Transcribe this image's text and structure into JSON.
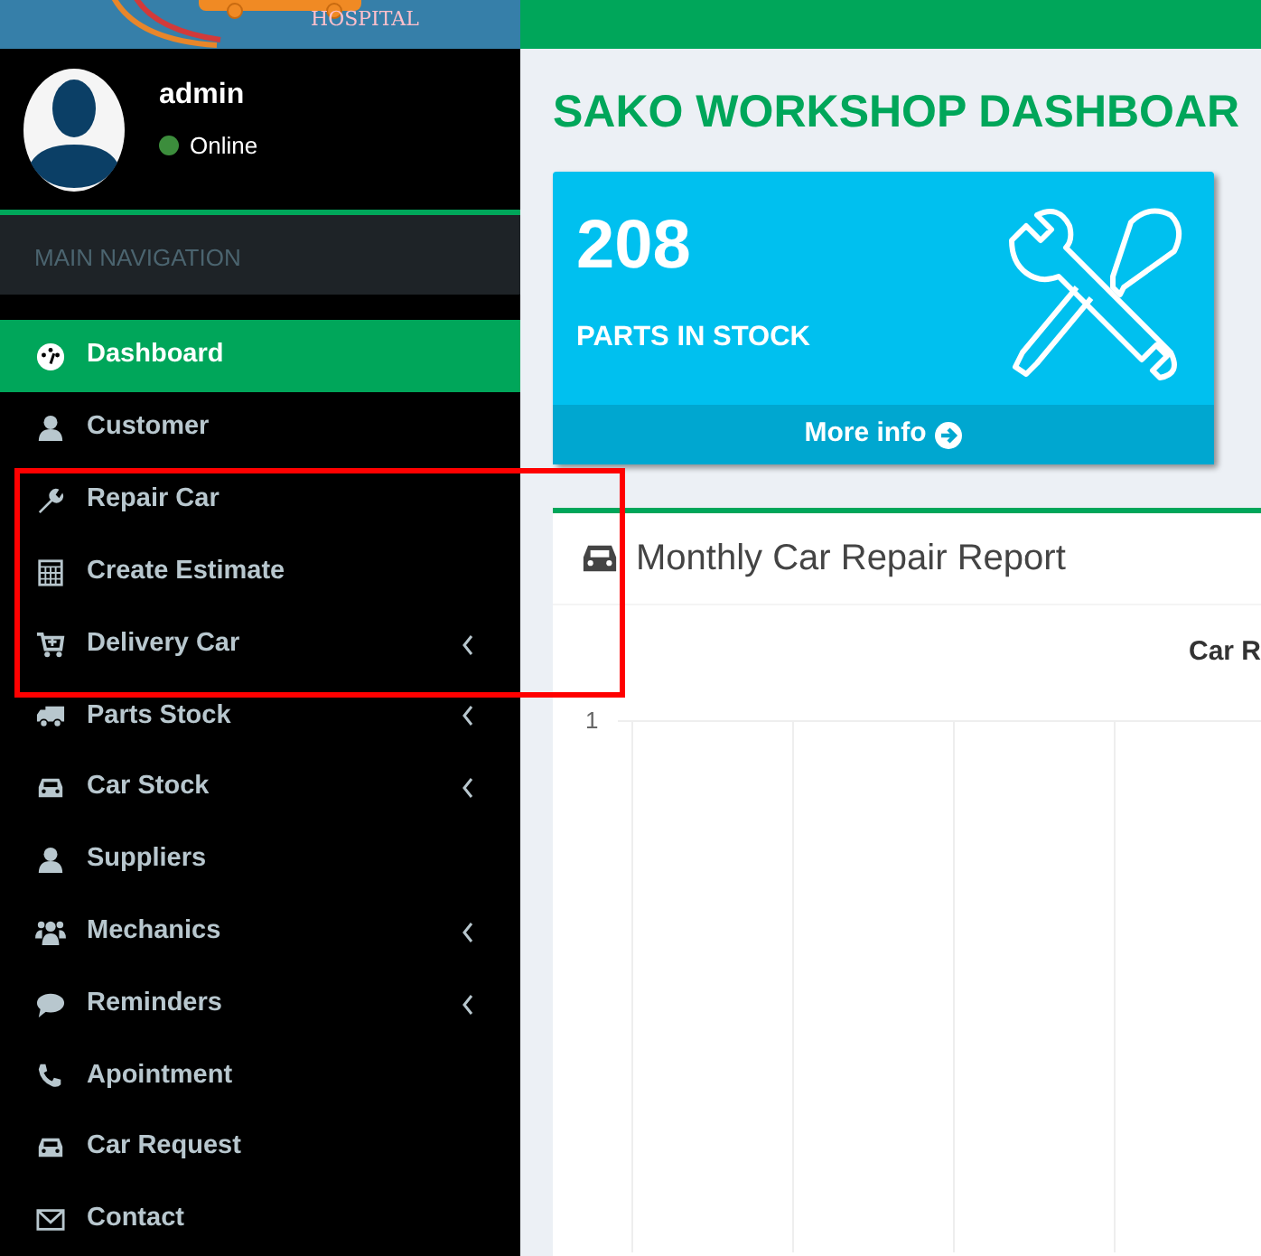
{
  "logo": {
    "text": "HOSPITAL"
  },
  "user": {
    "name": "admin",
    "status": "Online"
  },
  "sidebar": {
    "header": "MAIN NAVIGATION",
    "items": [
      {
        "label": "Dashboard",
        "kind": "dashboard",
        "selected": true,
        "has_submenu": false
      },
      {
        "label": "Customer",
        "kind": "user",
        "selected": false,
        "has_submenu": false
      },
      {
        "label": "Repair Car",
        "kind": "wrench",
        "selected": false,
        "has_submenu": false
      },
      {
        "label": "Create Estimate",
        "kind": "calculator",
        "selected": false,
        "has_submenu": false
      },
      {
        "label": "Delivery Car",
        "kind": "cart",
        "selected": false,
        "has_submenu": true
      },
      {
        "label": "Parts Stock",
        "kind": "truck",
        "selected": false,
        "has_submenu": true
      },
      {
        "label": "Car Stock",
        "kind": "car",
        "selected": false,
        "has_submenu": true
      },
      {
        "label": "Suppliers",
        "kind": "user",
        "selected": false,
        "has_submenu": false
      },
      {
        "label": "Mechanics",
        "kind": "users",
        "selected": false,
        "has_submenu": true
      },
      {
        "label": "Reminders",
        "kind": "comment",
        "selected": false,
        "has_submenu": true
      },
      {
        "label": "Apointment",
        "kind": "phone",
        "selected": false,
        "has_submenu": false
      },
      {
        "label": "Car Request",
        "kind": "car",
        "selected": false,
        "has_submenu": false
      },
      {
        "label": "Contact",
        "kind": "envelope",
        "selected": false,
        "has_submenu": false
      }
    ]
  },
  "highlight": {
    "color": "#ff0000"
  },
  "page_title": "SAKO WORKSHOP DASHBOAR",
  "stat_box": {
    "value": "208",
    "label": "PARTS IN STOCK",
    "link": "More info"
  },
  "report": {
    "title": "Monthly Car Repair Report",
    "chart_title": "Car R",
    "y_tick": "1"
  }
}
